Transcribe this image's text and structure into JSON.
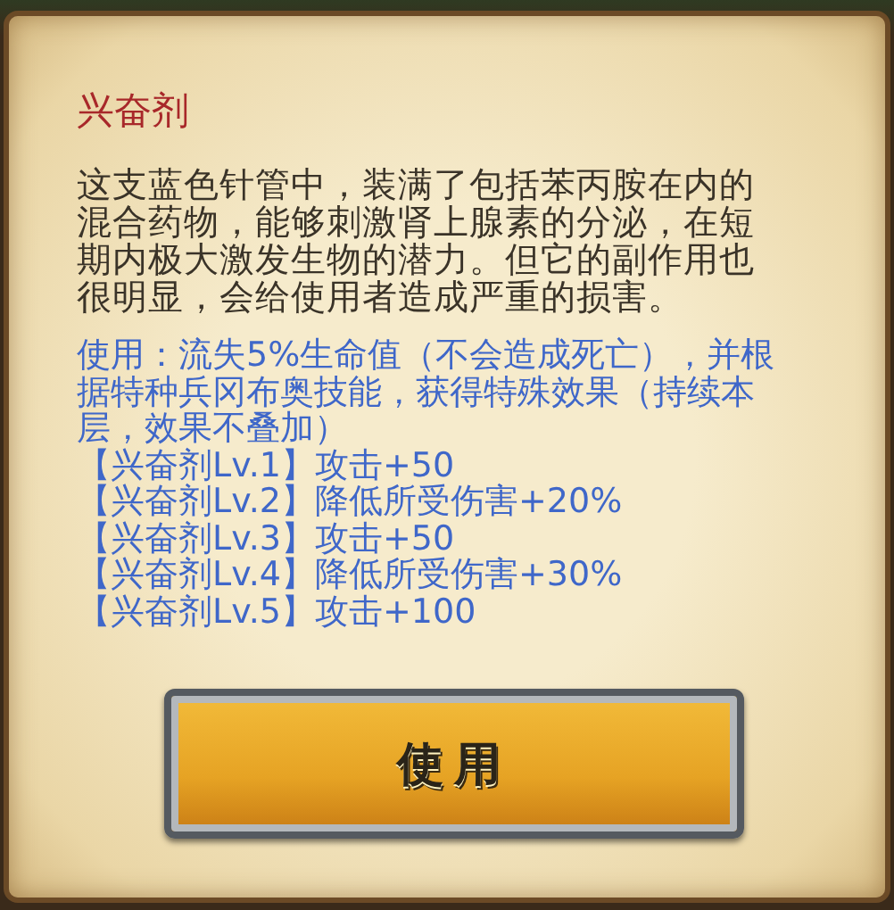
{
  "title": "兴奋剂",
  "description": "这支蓝色针管中，装满了包括苯丙胺在内的混合药物，能够刺激肾上腺素的分泌，在短期内极大激发生物的潜力。但它的副作用也很明显，会给使用者造成严重的损害。",
  "usage": "使用：流失5%生命值（不会造成死亡），并根据特种兵冈布奥技能，获得特殊效果（持续本层，效果不叠加）",
  "effects": [
    "【兴奋剂Lv.1】攻击+50",
    "【兴奋剂Lv.2】降低所受伤害+20%",
    "【兴奋剂Lv.3】攻击+50",
    "【兴奋剂Lv.4】降低所受伤害+30%",
    "【兴奋剂Lv.5】攻击+100"
  ],
  "button": "使用"
}
